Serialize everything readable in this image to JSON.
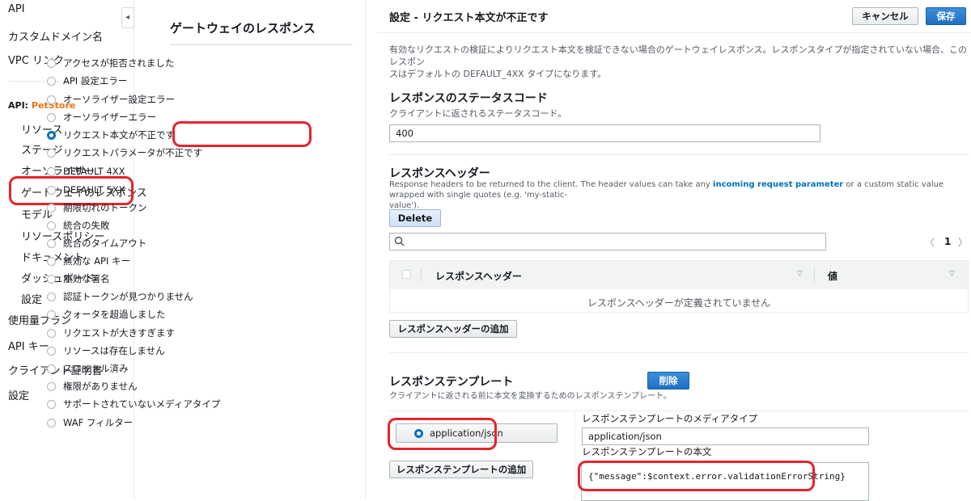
{
  "nav": {
    "top_items": [
      "API",
      "カスタムドメイン名",
      "VPC リンク"
    ],
    "api_prefix": "API:",
    "api_name": "PetStore",
    "sub_items": [
      "リソース",
      "ステージ",
      "オーソライザー",
      "ゲートウェイのレスポンス",
      "モデル",
      "リソースポリシー",
      "ドキュメント",
      "ダッシュボード",
      "設定"
    ],
    "bottom_items": [
      "使用量プラン",
      "API キー",
      "クライアント証明書",
      "設定"
    ],
    "collapse_glyph": "◂"
  },
  "responses": {
    "title": "ゲートウェイのレスポンス",
    "items": [
      "アクセスが拒否されました",
      "API 設定エラー",
      "オーソライザー設定エラー",
      "オーソライザーエラー",
      "リクエスト本文が不正です",
      "リクエストパラメータが不正です",
      "DEFAULT 4XX",
      "DEFAULT 5XX",
      "期限切れのトークン",
      "統合の失敗",
      "統合のタイムアウト",
      "無効な API キー",
      "無効な署名",
      "認証トークンが見つかりません",
      "クォータを超過しました",
      "リクエストが大きすぎます",
      "リソースは存在しません",
      "スロットル済み",
      "権限がありません",
      "サポートされていないメディアタイプ",
      "WAF フィルター"
    ],
    "selected_index": 4
  },
  "main": {
    "title": "設定 - リクエスト本文が不正です",
    "cancel_label": "キャンセル",
    "save_label": "保存",
    "intro_line1": "有効なリクエストの検証によりリクエスト本文を検証できない場合のゲートウェイレスポンス。レスポンスタイプが指定されていない場合、このレスポン",
    "intro_line2": "スはデフォルトの DEFAULT_4XX タイプになります。",
    "status_section": {
      "title": "レスポンスのステータスコード",
      "desc": "クライアントに返されるステータスコード。",
      "value": "400"
    },
    "headers_section": {
      "title": "レスポンスヘッダー",
      "desc_pre": "Response headers to be returned to the client. The header values can take any ",
      "desc_link": "incoming request parameter",
      "desc_post": " or a custom static value wrapped with single quotes (e.g. 'my-static-",
      "desc_line2": "value').",
      "delete_label": "Delete",
      "search_icon": "search-icon",
      "search_placeholder": "",
      "page_prev": "〈",
      "page_number": "1",
      "page_next": "〉",
      "col_header": "レスポンスヘッダー",
      "col_value": "値",
      "sort_glyph": "▽",
      "empty_text": "レスポンスヘッダーが定義されていません",
      "add_label": "レスポンスヘッダーの追加"
    },
    "template_section": {
      "title": "レスポンステンプレート",
      "desc": "クライアントに返される前に本文を変換するためのレスポンステンプレート。",
      "delete_label": "削除",
      "media_option": "application/json",
      "add_label": "レスポンステンプレートの追加",
      "media_type_label": "レスポンステンプレートのメディアタイプ",
      "media_type_value": "application/json",
      "body_label": "レスポンステンプレートの本文",
      "body_value": "{\"message\":$context.error.validationErrorString}"
    }
  },
  "colors": {
    "accent": "#0073bb",
    "brand": "#ec7211",
    "highlight": "#e8232b"
  }
}
